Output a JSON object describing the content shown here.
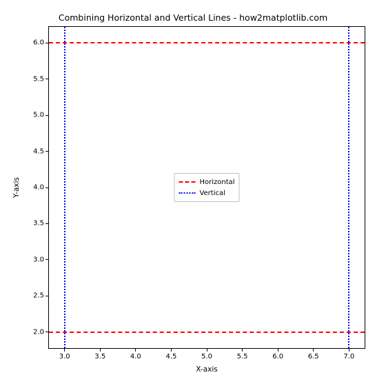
{
  "chart_data": {
    "type": "line",
    "title": "Combining Horizontal and Vertical Lines - how2matplotlib.com",
    "xlabel": "X-axis",
    "ylabel": "Y-axis",
    "xlim": [
      2.78,
      7.22
    ],
    "ylim": [
      1.78,
      6.22
    ],
    "xticks": [
      3.0,
      3.5,
      4.0,
      4.5,
      5.0,
      5.5,
      6.0,
      6.5,
      7.0
    ],
    "yticks": [
      2.0,
      2.5,
      3.0,
      3.5,
      4.0,
      4.5,
      5.0,
      5.5,
      6.0
    ],
    "series": [
      {
        "name": "Horizontal",
        "kind": "hline",
        "values": [
          2.0,
          6.0
        ],
        "color": "#ff0000",
        "style": "dashed"
      },
      {
        "name": "Vertical",
        "kind": "vline",
        "values": [
          3.0,
          7.0
        ],
        "color": "#0000ff",
        "style": "dotted"
      }
    ],
    "legend_position": "center"
  }
}
